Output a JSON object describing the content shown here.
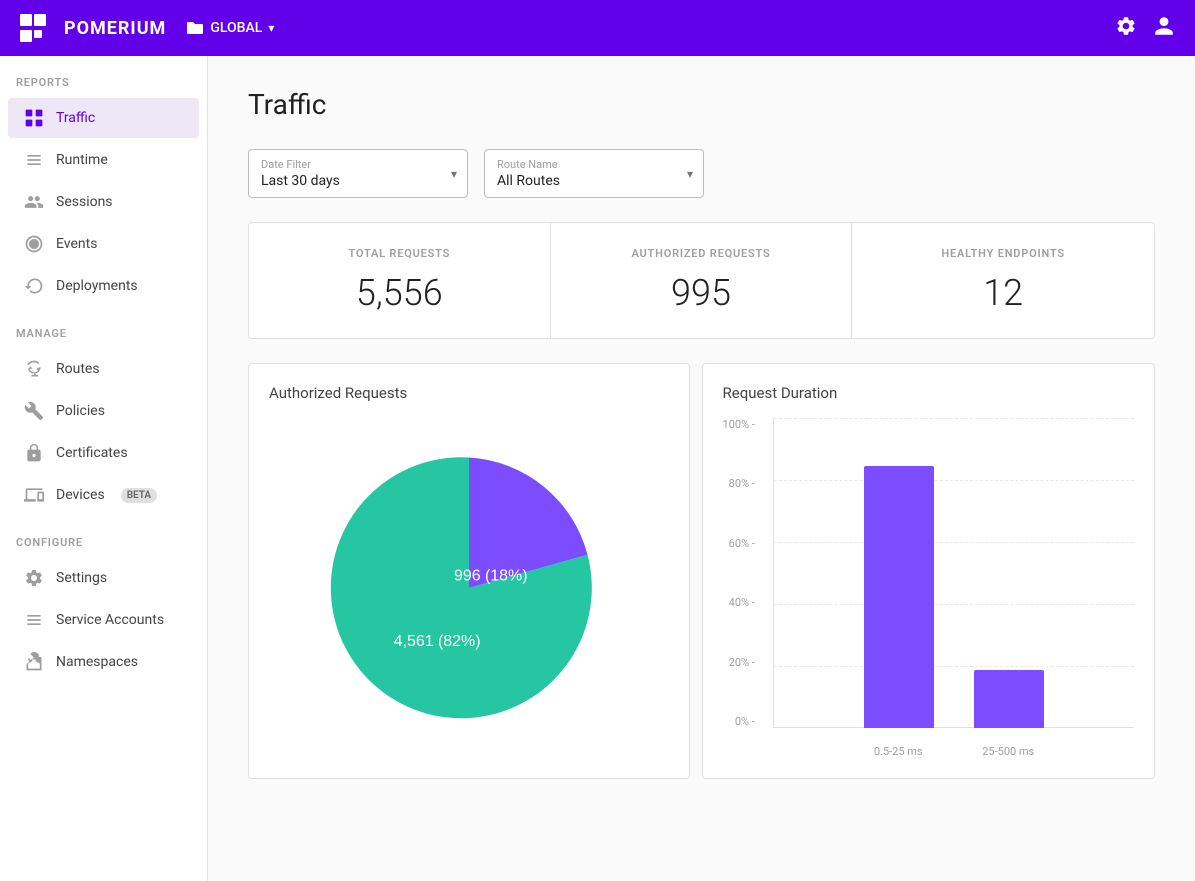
{
  "header": {
    "logo_text": "POMERIUM",
    "global_label": "GLOBAL",
    "settings_icon": "gear",
    "user_icon": "person"
  },
  "sidebar": {
    "reports_label": "REPORTS",
    "manage_label": "MANAGE",
    "configure_label": "CONFIGURE",
    "items": {
      "reports": [
        {
          "id": "traffic",
          "label": "Traffic",
          "active": true
        },
        {
          "id": "runtime",
          "label": "Runtime",
          "active": false
        },
        {
          "id": "sessions",
          "label": "Sessions",
          "active": false
        },
        {
          "id": "events",
          "label": "Events",
          "active": false
        },
        {
          "id": "deployments",
          "label": "Deployments",
          "active": false
        }
      ],
      "manage": [
        {
          "id": "routes",
          "label": "Routes",
          "active": false
        },
        {
          "id": "policies",
          "label": "Policies",
          "active": false
        },
        {
          "id": "certificates",
          "label": "Certificates",
          "active": false
        },
        {
          "id": "devices",
          "label": "Devices",
          "active": false,
          "badge": "BETA"
        }
      ],
      "configure": [
        {
          "id": "settings",
          "label": "Settings",
          "active": false
        },
        {
          "id": "service-accounts",
          "label": "Service Accounts",
          "active": false
        },
        {
          "id": "namespaces",
          "label": "Namespaces",
          "active": false
        }
      ]
    }
  },
  "page": {
    "title": "Traffic",
    "date_filter_label": "Date Filter",
    "date_filter_value": "Last 30 days",
    "route_name_label": "Route Name",
    "route_name_value": "All Routes"
  },
  "stats": {
    "total_requests_label": "TOTAL REQUESTS",
    "total_requests_value": "5,556",
    "authorized_requests_label": "AUTHORIZED REQUESTS",
    "authorized_requests_value": "995",
    "healthy_endpoints_label": "HEALTHY ENDPOINTS",
    "healthy_endpoints_value": "12"
  },
  "pie_chart": {
    "title": "Authorized Requests",
    "slice1_value": 4561,
    "slice1_pct": 82,
    "slice1_label": "4,561 (82%)",
    "slice1_color": "#26c6a2",
    "slice2_value": 996,
    "slice2_pct": 18,
    "slice2_label": "996 (18%)",
    "slice2_color": "#7c4dff"
  },
  "bar_chart": {
    "title": "Request Duration",
    "y_labels": [
      "100%",
      "80%",
      "60%",
      "40%",
      "20%",
      "0%"
    ],
    "bars": [
      {
        "label": "0.5-25 ms",
        "height_pct": 82,
        "color": "#7c4dff"
      },
      {
        "label": "25-500 ms",
        "height_pct": 18,
        "color": "#7c4dff"
      }
    ]
  },
  "colors": {
    "purple": "#6200ea",
    "purple_light": "#7c4dff",
    "teal": "#26c6a2",
    "active_bg": "#ede7f6"
  }
}
